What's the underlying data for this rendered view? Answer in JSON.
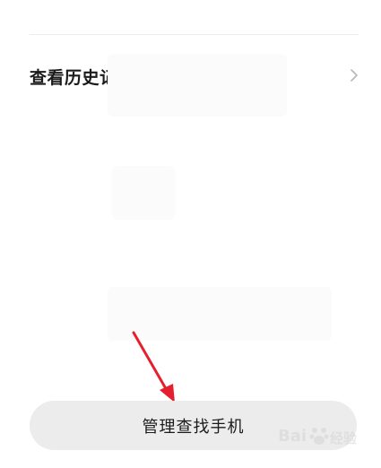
{
  "history": {
    "label": "查看历史记录"
  },
  "manage_button": {
    "label": "管理查找手机"
  },
  "watermark": {
    "brand": "Bai",
    "suffix": "经验"
  },
  "colors": {
    "background": "#ffffff",
    "divider": "#ececec",
    "button_bg": "#ececec",
    "arrow": "#e5202e",
    "text": "#1b1b1b",
    "chevron": "#b8b8b8"
  }
}
